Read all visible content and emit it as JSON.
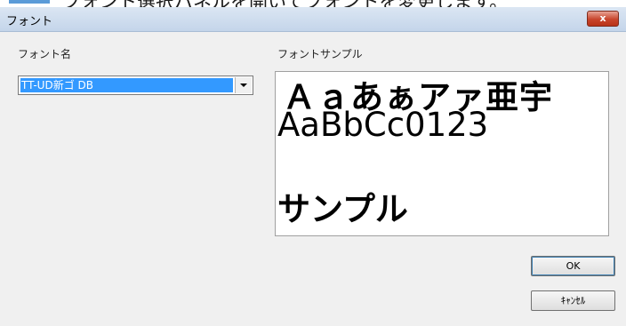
{
  "caption": {
    "text": "フォント選択パネルを開いてフォントを変更します。"
  },
  "window": {
    "title": "フォント",
    "close_label": "x"
  },
  "font_name": {
    "label": "フォント名",
    "selected": "TT-UD新ゴ DB"
  },
  "sample": {
    "label": "フォントサンプル",
    "line1": "Ａａあぁアァ亜宇",
    "line2": "AaBbCc0123",
    "line3": "サンプル"
  },
  "buttons": {
    "ok": "OK",
    "cancel": "ｷｬﾝｾﾙ"
  },
  "colors": {
    "selection": "#3399ff",
    "close_button": "#c8452c",
    "title_bar": "#c4d5ea"
  }
}
